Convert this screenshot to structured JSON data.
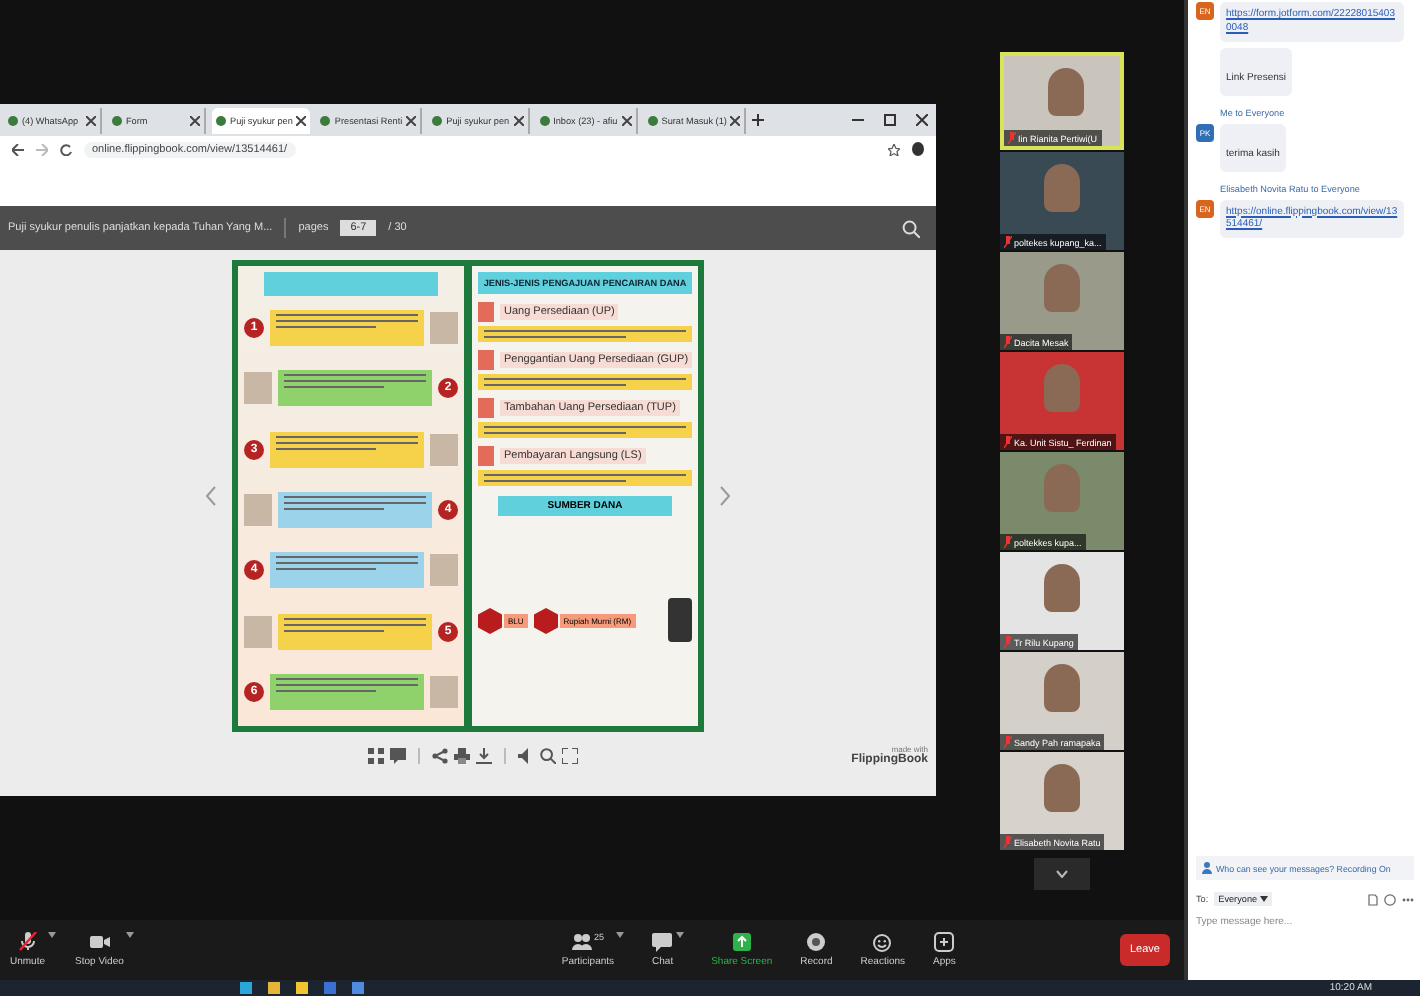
{
  "browser": {
    "tabs": [
      {
        "label": "(4) WhatsApp",
        "selected": false
      },
      {
        "label": "Form",
        "selected": false
      },
      {
        "label": "Puji syukur pen",
        "selected": true
      },
      {
        "label": "Presentasi Renti",
        "selected": false
      },
      {
        "label": "Puji syukur pen",
        "selected": false
      },
      {
        "label": "Inbox (23) - afiu",
        "selected": false
      },
      {
        "label": "Surat Masuk (1)",
        "selected": false
      }
    ],
    "url": "online.flippingbook.com/view/13514461/",
    "flipbook": {
      "title": "Puji syukur penulis panjatkan kepada Tuhan Yang M...",
      "pages_label": "pages",
      "page_value": "6-7",
      "page_total": "/ 30",
      "left_page": {
        "steps": [
          "1",
          "2",
          "3",
          "4",
          "4",
          "5",
          "6"
        ]
      },
      "right_page": {
        "heading": "JENIS-JENIS PENGAJUAN PENCAIRAN DANA",
        "sections": [
          "Uang Persediaan (UP)",
          "Penggantian Uang Persediaan (GUP)",
          "Tambahan Uang Persediaan (TUP)",
          "Pembayaran Langsung (LS)"
        ],
        "funding_title": "SUMBER DANA",
        "funding": [
          "BLU",
          "Rupiah Murni (RM)"
        ]
      },
      "brand_small": "made with",
      "brand": "FlippingBook"
    }
  },
  "videos": [
    {
      "name": "Iin Rianita Pertiwi(U",
      "speaking": true
    },
    {
      "name": "poltekes kupang_ka...",
      "speaking": false
    },
    {
      "name": "Dacita Mesak",
      "speaking": false
    },
    {
      "name": "Ka. Unit Sistu_ Ferdinan",
      "speaking": false
    },
    {
      "name": "poltekkes kupa...",
      "speaking": false
    },
    {
      "name": "Tr Rilu Kupang",
      "speaking": false
    },
    {
      "name": "Sandy Pah ramapaka",
      "speaking": false
    },
    {
      "name": "Elisabeth Novita Ratu",
      "speaking": false
    }
  ],
  "chat": {
    "messages": [
      {
        "kind": "bubble",
        "avatar": "EN",
        "color": "#d9641e",
        "text": "https://form.jotform.com/222280154030048",
        "link": true
      },
      {
        "kind": "bubble",
        "text": "Link Presensi",
        "link": false
      },
      {
        "kind": "header",
        "text": "Me to Everyone"
      },
      {
        "kind": "bubble",
        "avatar": "PK",
        "color": "#2f6fb5",
        "text": "terima kasih",
        "link": false
      },
      {
        "kind": "header",
        "text": "Elisabeth Novita Ratu to Everyone"
      },
      {
        "kind": "bubble",
        "avatar": "EN",
        "color": "#d9641e",
        "text": "https://online.flippingbook.com/view/13514461/",
        "link": true
      }
    ],
    "notice": "Who can see your messages? Recording On",
    "to_label": "To:",
    "to_value": "Everyone",
    "placeholder": "Type message here..."
  },
  "toolbar": {
    "buttons": [
      {
        "kind": "mic",
        "label": "Unmute",
        "caret": true
      },
      {
        "kind": "video",
        "label": "Stop Video",
        "caret": true
      },
      {
        "kind": "participants",
        "label": "Participants",
        "count": "25",
        "caret": true
      },
      {
        "kind": "chat",
        "label": "Chat",
        "caret": true
      },
      {
        "kind": "share",
        "label": "Share Screen",
        "caret": false
      },
      {
        "kind": "record",
        "label": "Record",
        "caret": false
      },
      {
        "kind": "reactions",
        "label": "Reactions",
        "caret": false
      },
      {
        "kind": "apps",
        "label": "Apps",
        "caret": false
      }
    ],
    "leave": "Leave"
  },
  "clock": "10:20 AM"
}
